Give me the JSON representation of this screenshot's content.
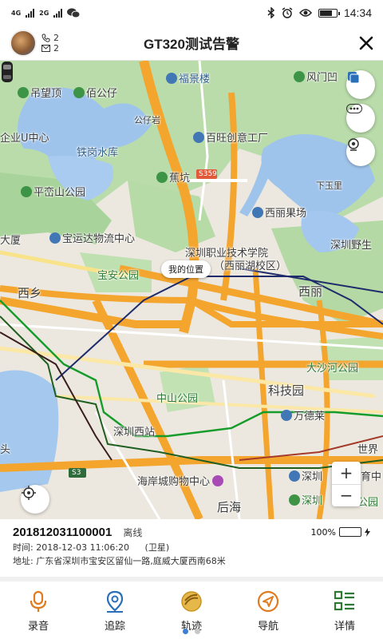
{
  "status_bar": {
    "network_1": "4G",
    "network_2": "2G",
    "time": "14:34"
  },
  "header": {
    "title": "GT320测试告警",
    "calls_count": "2",
    "messages_count": "2",
    "close_icon": "close-icon"
  },
  "map": {
    "labels": {
      "fujinglou": "福景楼",
      "fengmenao": "风门凹",
      "diaowangding": "吊望顶",
      "baigonglou": "佰公仔",
      "gongzi_yan": "公仔岩",
      "baiwang": "百旺创意工厂",
      "chanye_center": "企业U中心",
      "tiegang": "铁岗水库",
      "jiaokeng": "蕉坑",
      "xiaxiali": "下玉里",
      "pingluan_park": "平峦山公园",
      "xili_orchard": "西丽果场",
      "dasha": "大厦",
      "baoyunda": "宝运达物流中心",
      "polytech": "深圳职业技术学院",
      "polytech_campus": "（西丽湖校区）",
      "shenzhen_wild": "深圳野生",
      "baoan_park": "宝安公园",
      "xixiang": "西乡",
      "xili": "西丽",
      "dashahe_park": "大沙河公园",
      "zhongshan_park": "中山公园",
      "kejiyuan": "科技园",
      "wandelai": "万德莱",
      "shenzhen_west": "深圳西站",
      "shijie": "世界",
      "tou": "头",
      "s3": "S3",
      "s359": "S359",
      "haian_mall": "海岸城购物中心",
      "houhai": "后海",
      "shenzhen_bay": "深圳",
      "shenzhen_bay_park": "深圳",
      "yuzhong": "育中",
      "park_suffix": "公园"
    },
    "my_position": "我的位置",
    "zoom_in": "+",
    "zoom_out": "−"
  },
  "device": {
    "id": "201812031100001",
    "status": "离线",
    "battery": "100%",
    "battery_level": 1.0,
    "time_label": "时间: 2018-12-03 11:06:20",
    "positioning": "(卫星)",
    "address": "地址: 广东省深圳市宝安区留仙一路,庭威大厦西南68米"
  },
  "nav": {
    "items": [
      {
        "label": "录音",
        "icon": "microphone-icon"
      },
      {
        "label": "追踪",
        "icon": "location-pin-icon"
      },
      {
        "label": "轨迹",
        "icon": "track-icon"
      },
      {
        "label": "导航",
        "icon": "navigation-icon"
      },
      {
        "label": "详情",
        "icon": "details-icon"
      }
    ]
  },
  "colors": {
    "accent_orange": "#e07b1f",
    "accent_blue": "#2a6fb8",
    "battery_green": "#2fa84f",
    "page_dot_active": "#3e7fd6"
  }
}
